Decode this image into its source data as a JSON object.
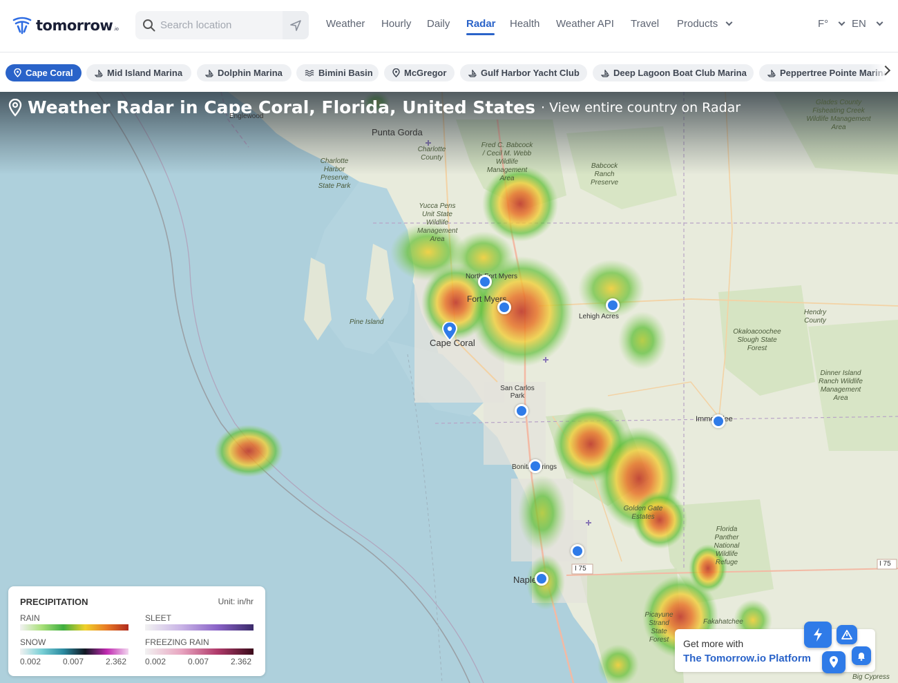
{
  "header": {
    "logo_text": "tomorrow",
    "logo_sub": ".io",
    "search_placeholder": "Search location",
    "nav": [
      "Weather",
      "Hourly",
      "Daily",
      "Radar",
      "Health",
      "Weather API",
      "Travel"
    ],
    "nav_active": "Radar",
    "products_label": "Products",
    "unit_label": "F°",
    "lang_label": "EN"
  },
  "chips": [
    {
      "label": "Cape Coral",
      "icon": "location-pin-icon",
      "active": true
    },
    {
      "label": "Mid Island Marina",
      "icon": "boat-icon"
    },
    {
      "label": "Dolphin Marina",
      "icon": "boat-icon"
    },
    {
      "label": "Bimini Basin",
      "icon": "waves-icon"
    },
    {
      "label": "McGregor",
      "icon": "location-pin-icon"
    },
    {
      "label": "Gulf Harbor Yacht Club",
      "icon": "boat-icon"
    },
    {
      "label": "Deep Lagoon Boat Club Marina",
      "icon": "boat-icon"
    },
    {
      "label": "Peppertree Pointe Marina",
      "icon": "boat-icon"
    }
  ],
  "map": {
    "title": "Weather Radar in Cape Coral, Florida, United States",
    "subtitle": "· View entire country on Radar",
    "places": {
      "punta_gorda": "Punta Gorda",
      "englewood": "Englewood",
      "cape_coral": "Cape Coral",
      "north_fort_myers": "North Fort Myers",
      "fort_myers": "Fort Myers",
      "lehigh_acres": "Lehigh Acres",
      "pine_island": "Pine Island",
      "san_carlos_park": "San Carlos Park",
      "bonita_springs": "Bonita Springs",
      "naples": "Naples",
      "immokalee": "Immokalee",
      "babcock_ranch": "Babcock Ranch Preserve",
      "fred_babcock": "Fred C. Babcock / Cecil M. Webb Wildlife Management Area",
      "charlotte_harbor": "Charlotte Harbor Preserve State Park",
      "charlotte_county": "Charlotte County",
      "yucca_pens": "Yucca Pens Unit State Wildlife Management Area",
      "hendry_county": "Hendry County",
      "okaloacoochee": "Okaloacoochee Slough State Forest",
      "dinner_island": "Dinner Island Ranch Wildlife Management Area",
      "fisheating": "Glades County Fisheating Creek Wildlife Management Area",
      "golden_gate": "Golden Gate Estates",
      "panther": "Florida Panther National Wildlife Refuge",
      "fakahatchee": "Fakahatchee",
      "picayune": "Picayune Strand State Forest",
      "big_cypress": "Big Cypress",
      "i75_a": "I 75",
      "i75_b": "I 75"
    }
  },
  "legend": {
    "title": "PRECIPITATION",
    "unit": "Unit: in/hr",
    "rain": "RAIN",
    "sleet": "SLEET",
    "snow": "SNOW",
    "freezing_rain": "FREEZING RAIN",
    "ticks": [
      "0.002",
      "0.007",
      "2.362"
    ],
    "colors": {
      "rain": [
        "#f2f2f2",
        "#a9e07a",
        "#3fae3f",
        "#f0d12a",
        "#e87a25",
        "#b02a1e"
      ],
      "sleet": [
        "#f2f2f2",
        "#c9b4e6",
        "#8a63c7",
        "#3a2a6a"
      ],
      "snow": [
        "#f2f2f2",
        "#7ad0d6",
        "#2a8aa0",
        "#111822",
        "#c02ab0",
        "#f2d6ef"
      ],
      "freezing_rain": [
        "#f2f2f2",
        "#e8a5c0",
        "#b03a6a",
        "#3a0a1a"
      ]
    }
  },
  "promo": {
    "line1": "Get more with",
    "line2": "The Tomorrow.io Platform"
  },
  "colors": {
    "accent": "#2a63c9",
    "marker": "#2f7be8",
    "water": "#aed0dc",
    "land": "#e9ecdf"
  }
}
